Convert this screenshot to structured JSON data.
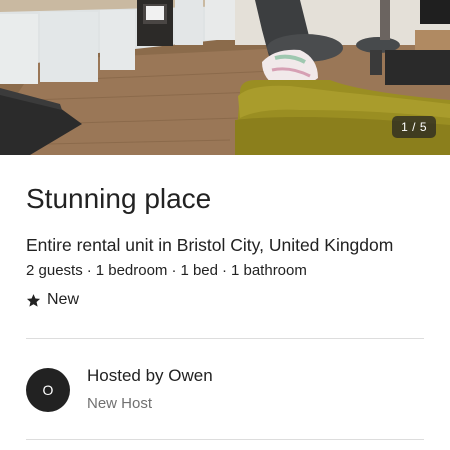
{
  "colors": {
    "text_primary": "#222222",
    "text_secondary": "#717171",
    "divider": "#dddddd",
    "avatar_bg": "#222222"
  },
  "photo": {
    "counter": "1 / 5",
    "description_icon": "listing-photo"
  },
  "listing": {
    "title": "Stunning place",
    "subtitle": "Entire rental unit in Bristol City, United Kingdom",
    "details": [
      "2 guests",
      "1 bedroom",
      "1 bed",
      "1 bathroom"
    ],
    "details_separator": "·",
    "badge_icon": "star-icon",
    "badge_label": "New"
  },
  "host": {
    "avatar_initial": "O",
    "name": "Hosted by Owen",
    "status": "New Host"
  }
}
